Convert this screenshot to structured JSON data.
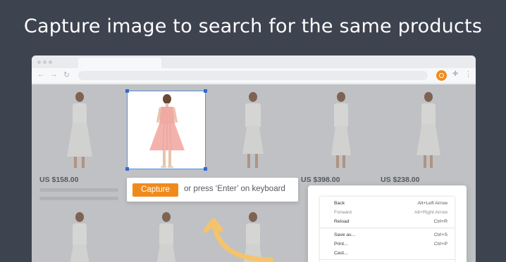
{
  "headline": "Capture image to search for the same products",
  "products": [
    {
      "price": "US $158.00"
    },
    {
      "price": ""
    },
    {
      "price": ""
    },
    {
      "price": "US $398.00"
    },
    {
      "price": "US $238.00"
    }
  ],
  "capture": {
    "button_label": "Capture",
    "hint": "or press ‘Enter’ on keyboard"
  },
  "context_menu": {
    "items": [
      {
        "label": "Back",
        "shortcut": "Alt+Left Arrow"
      },
      {
        "label": "Forward",
        "shortcut": "Alt+Right Arrow"
      },
      {
        "label": "Reload",
        "shortcut": "Ctrl+R"
      },
      {
        "label": "Save as...",
        "shortcut": "Ctrl+S"
      },
      {
        "label": "Print...",
        "shortcut": "Ctrl+P"
      },
      {
        "label": "Cast...",
        "shortcut": ""
      }
    ]
  },
  "colors": {
    "background": "#3e4350",
    "accent": "#f08b1b",
    "selection_border": "#2f6ad0",
    "arrow": "#f5c36b"
  },
  "icons": [
    "back-arrow-icon",
    "forward-arrow-icon",
    "reload-icon",
    "image-search-extension-icon",
    "puzzle-icon",
    "kebab-menu-icon"
  ]
}
